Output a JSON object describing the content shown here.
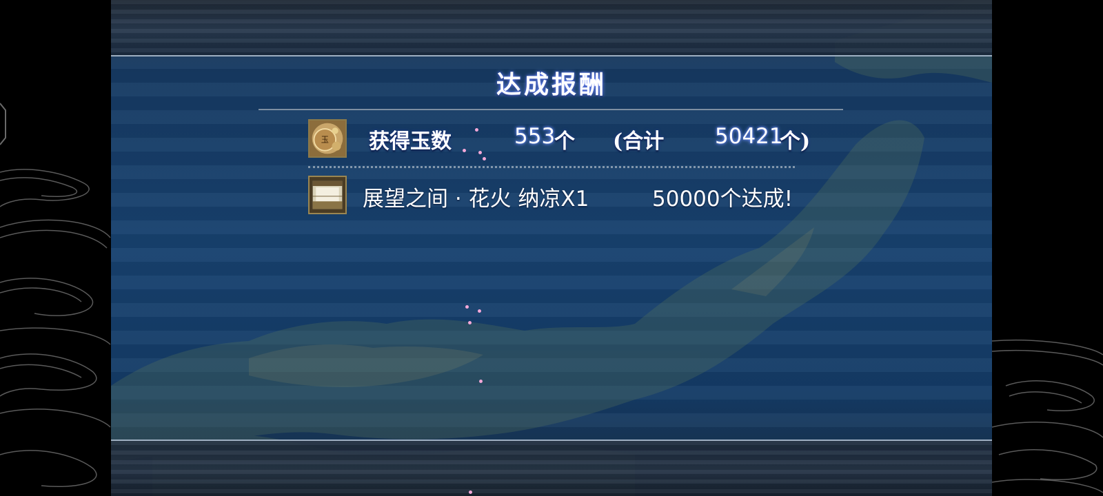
{
  "dialog": {
    "title": "达成报酬"
  },
  "jade_row": {
    "icon": "jade-coin-icon",
    "label": "获得玉数",
    "gained": "553",
    "gained_unit": "个",
    "total_prefix": "(合计",
    "total": "50421",
    "total_suffix": "个)"
  },
  "reward_row": {
    "icon": "room-scene-icon",
    "item": "展望之间 · 花火 纳凉X1",
    "condition": "50000个达成!"
  },
  "colors": {
    "panel_blue": "#17416f",
    "title_glow": "#6f8cff",
    "rule": "#9fb0c2"
  }
}
